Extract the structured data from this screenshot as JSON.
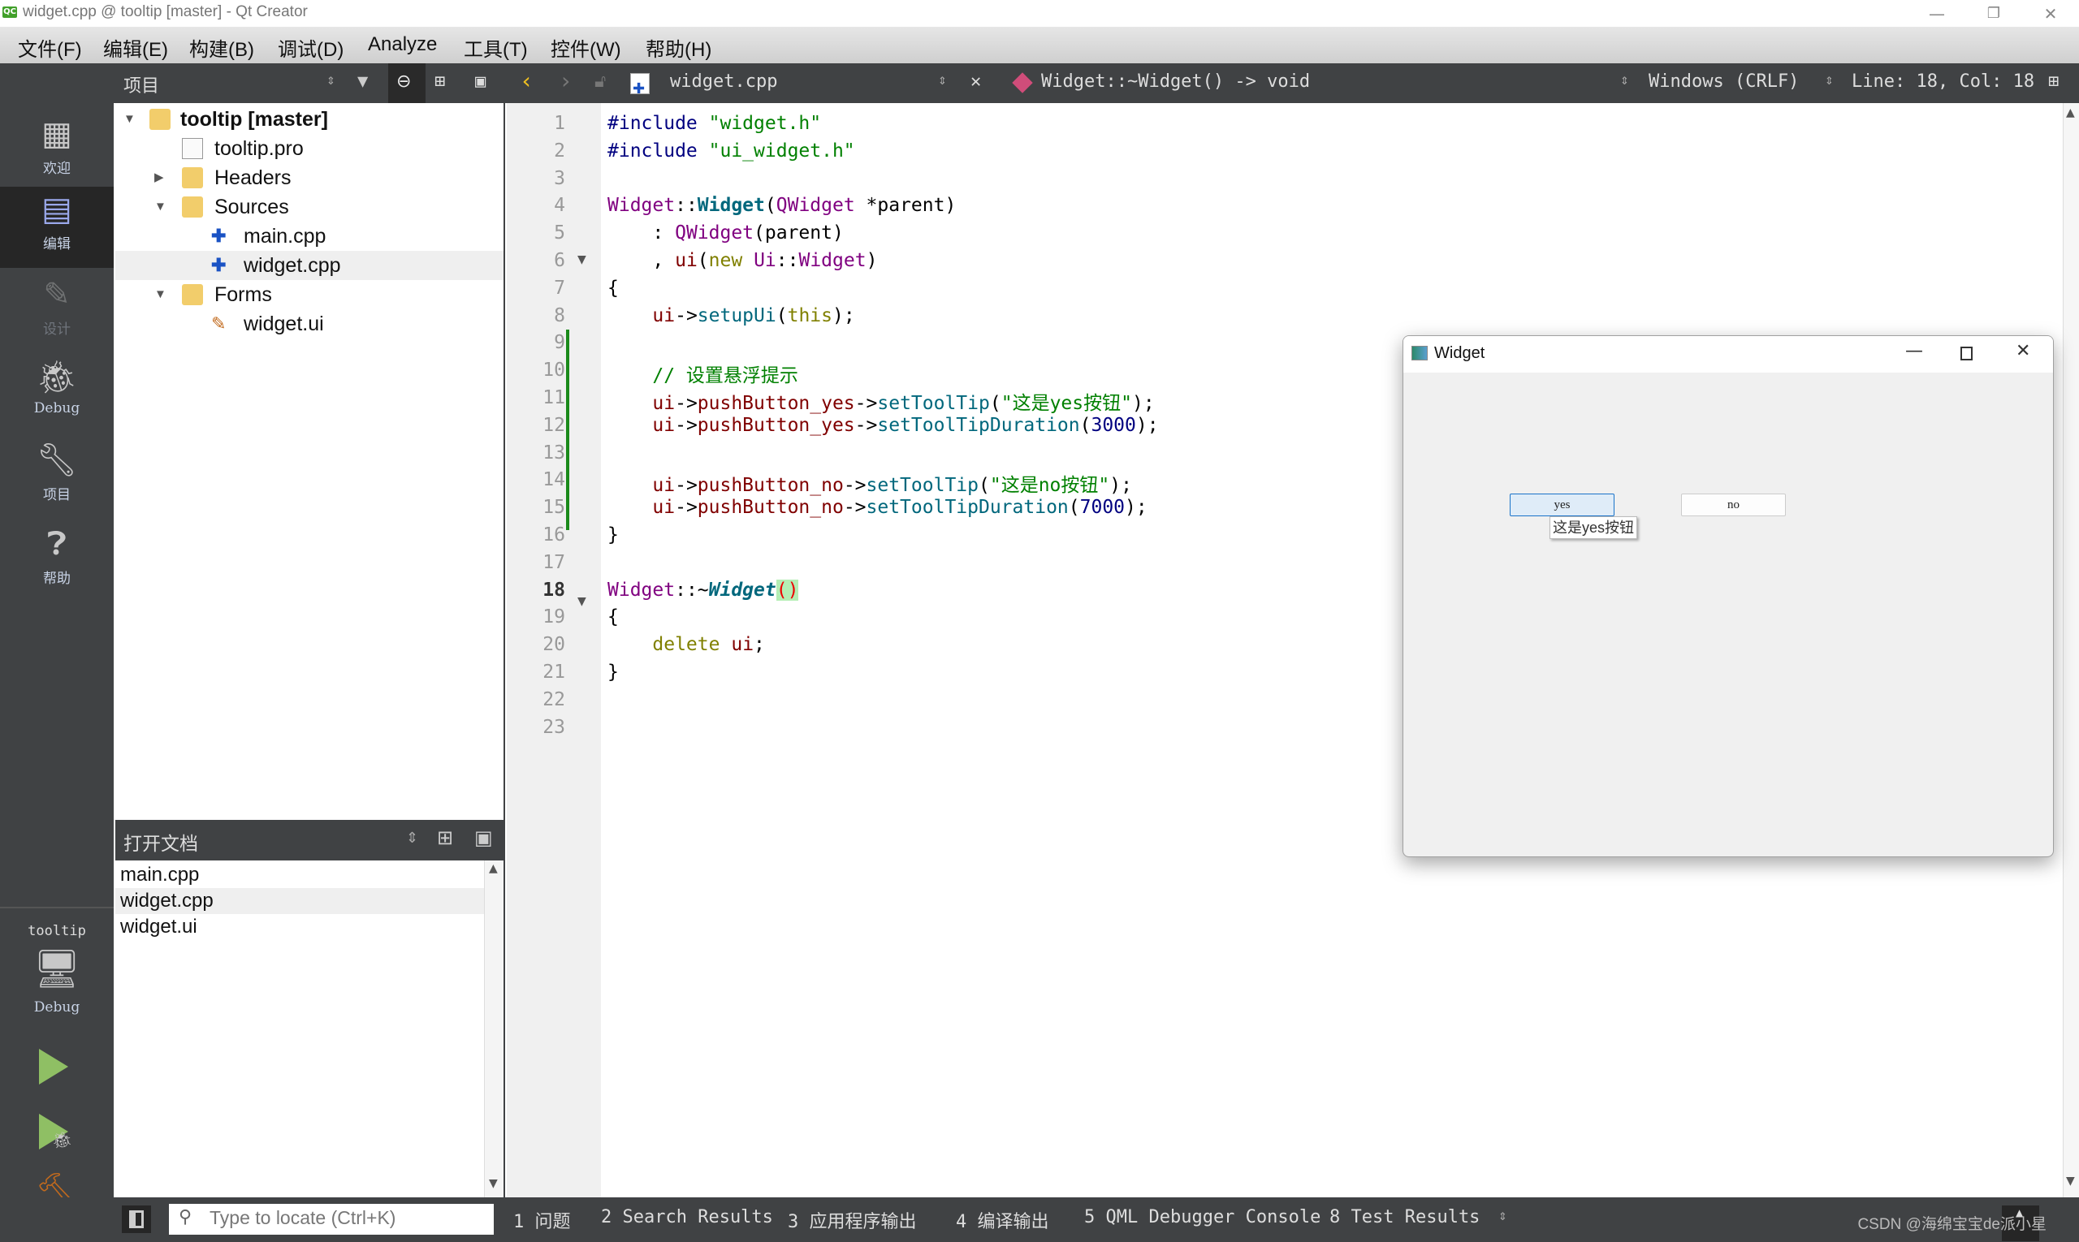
{
  "window": {
    "title": "widget.cpp @ tooltip [master] - Qt Creator",
    "app_icon": "QC",
    "controls": {
      "minimize": "—",
      "restore": "❐",
      "close": "✕"
    }
  },
  "menu": [
    "文件(F)",
    "编辑(E)",
    "构建(B)",
    "调试(D)",
    "Analyze",
    "工具(T)",
    "控件(W)",
    "帮助(H)"
  ],
  "toolbar": {
    "project_selector": "项目",
    "file_name": "widget.cpp",
    "symbol": "Widget::~Widget() -> void",
    "line_ending": "Windows (CRLF)",
    "cursor_pos": "Line: 18, Col: 18"
  },
  "modes": [
    {
      "label": "欢迎",
      "icon": "grid-icon"
    },
    {
      "label": "编辑",
      "icon": "edit-doc-icon",
      "active": true
    },
    {
      "label": "设计",
      "icon": "pencil-icon",
      "disabled": true
    },
    {
      "label": "Debug",
      "icon": "bug-icon"
    },
    {
      "label": "项目",
      "icon": "wrench-icon"
    },
    {
      "label": "帮助",
      "icon": "help-icon"
    }
  ],
  "kit": {
    "project": "tooltip",
    "build": "Debug"
  },
  "project_tree": [
    {
      "label": "tooltip [master]",
      "bold": true,
      "expanded": true
    },
    {
      "label": "tooltip.pro"
    },
    {
      "label": "Headers",
      "expanded": false
    },
    {
      "label": "Sources",
      "expanded": true
    },
    {
      "label": "main.cpp"
    },
    {
      "label": "widget.cpp",
      "selected": true
    },
    {
      "label": "Forms",
      "expanded": true
    },
    {
      "label": "widget.ui"
    }
  ],
  "open_docs": {
    "title": "打开文档",
    "items": [
      "main.cpp",
      "widget.cpp",
      "widget.ui"
    ],
    "selected": "widget.cpp"
  },
  "editor": {
    "current_line": 18,
    "lines": [
      "#include \"widget.h\"",
      "#include \"ui_widget.h\"",
      "",
      "Widget::Widget(QWidget *parent)",
      "    : QWidget(parent)",
      "    , ui(new Ui::Widget)",
      "{",
      "    ui->setupUi(this);",
      "",
      "    // 设置悬浮提示",
      "    ui->pushButton_yes->setToolTip(\"这是yes按钮\");",
      "    ui->pushButton_yes->setToolTipDuration(3000);",
      "",
      "    ui->pushButton_no->setToolTip(\"这是no按钮\");",
      "    ui->pushButton_no->setToolTipDuration(7000);",
      "}",
      "",
      "Widget::~Widget()",
      "{",
      "    delete ui;",
      "}",
      "",
      ""
    ]
  },
  "locator": {
    "placeholder": "Type to locate (Ctrl+K)"
  },
  "output_tabs": [
    "1 问题",
    "2 Search Results",
    "3 应用程序输出",
    "4 编译输出",
    "5 QML Debugger Console",
    "8 Test Results"
  ],
  "watermark": "CSDN @海绵宝宝de派小星",
  "widget_window": {
    "title": "Widget",
    "buttons": [
      {
        "label": "yes",
        "focused": true
      },
      {
        "label": "no"
      }
    ],
    "tooltip": "这是yes按钮"
  }
}
